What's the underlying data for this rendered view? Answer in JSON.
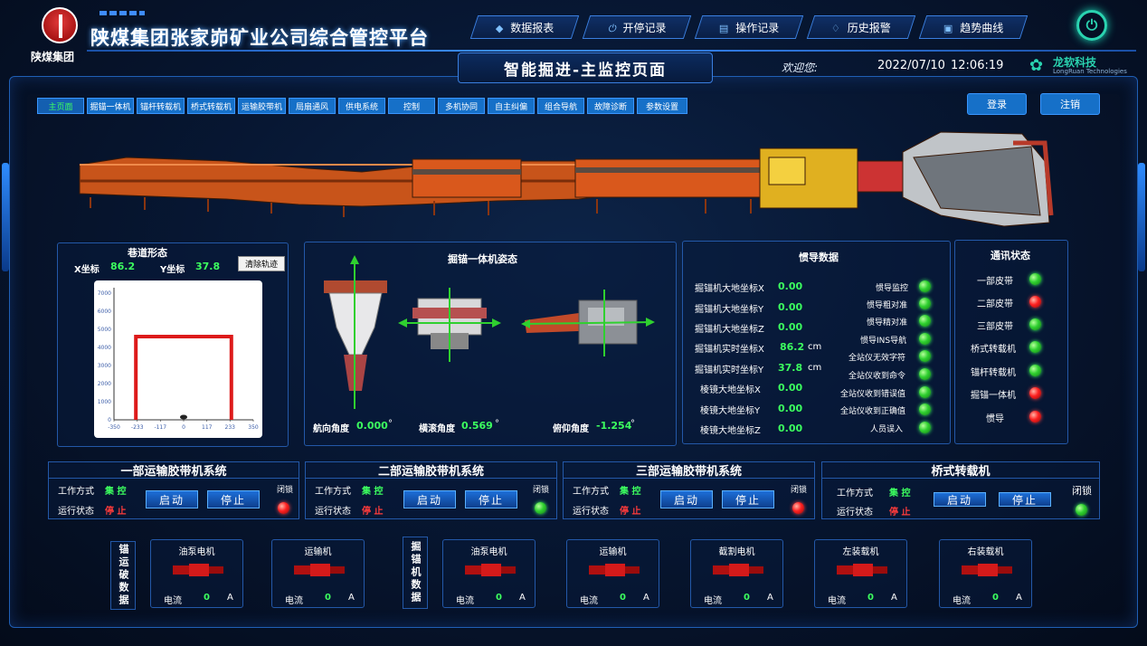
{
  "header": {
    "logo_text": "陕煤集团",
    "app_title": "陕煤集团张家峁矿业公司综合管控平台",
    "page_subtitle": "智能掘进-主监控页面",
    "welcome": "欢迎您:",
    "date": "2022/07/10",
    "time": "12:06:19",
    "brand_name": "龙软科技",
    "brand_sub": "LongRuan Technologies",
    "nav": [
      {
        "label": "数据报表",
        "icon": "database-icon"
      },
      {
        "label": "开停记录",
        "icon": "power-icon"
      },
      {
        "label": "操作记录",
        "icon": "document-icon"
      },
      {
        "label": "历史报警",
        "icon": "bell-icon"
      },
      {
        "label": "趋势曲线",
        "icon": "chart-icon"
      }
    ]
  },
  "tabs": [
    "主页面",
    "掘锚一体机",
    "锚杆转载机",
    "桥式转载机",
    "运输胶带机",
    "局扇通风",
    "供电系统",
    "控制",
    "多机协同",
    "自主纠偏",
    "组合导航",
    "故障诊断",
    "参数设置"
  ],
  "auth": {
    "login": "登录",
    "logout": "注销"
  },
  "roadway": {
    "title": "巷道形态",
    "x_label": "X坐标",
    "x_value": "86.2",
    "y_label": "Y坐标",
    "y_value": "37.8",
    "clear_button": "清除轨迹",
    "chart_data": {
      "type": "line",
      "x_ticks": [
        "-350",
        "-233",
        "-117",
        "0",
        "117",
        "233",
        "350"
      ],
      "y_ticks": [
        "0",
        "1000",
        "2000",
        "3000",
        "4000",
        "5000",
        "6000",
        "7000"
      ],
      "xlim": [
        -350,
        350
      ],
      "ylim": [
        0,
        7300
      ],
      "outline": {
        "x": [
          -240,
          -240,
          240,
          240
        ],
        "y": [
          0,
          4600,
          4600,
          0
        ],
        "color": "#dd1a1a"
      }
    }
  },
  "attitude": {
    "title": "掘锚一体机姿态",
    "heading_label": "航向角度",
    "heading_value": "0.000",
    "heading_unit": "°",
    "roll_label": "横滚角度",
    "roll_value": "0.569",
    "roll_unit": "°",
    "pitch_label": "俯仰角度",
    "pitch_value": "-1.254",
    "pitch_unit": "°"
  },
  "inertial": {
    "title": "惯导数据",
    "rows": [
      {
        "label": "掘锚机大地坐标X",
        "value": "0.00",
        "unit": ""
      },
      {
        "label": "掘锚机大地坐标Y",
        "value": "0.00",
        "unit": ""
      },
      {
        "label": "掘锚机大地坐标Z",
        "value": "0.00",
        "unit": ""
      },
      {
        "label": "掘锚机实时坐标X",
        "value": "86.2",
        "unit": "cm"
      },
      {
        "label": "掘锚机实时坐标Y",
        "value": "37.8",
        "unit": "cm"
      },
      {
        "label": "棱镜大地坐标X",
        "value": "0.00",
        "unit": ""
      },
      {
        "label": "棱镜大地坐标Y",
        "value": "0.00",
        "unit": ""
      },
      {
        "label": "棱镜大地坐标Z",
        "value": "0.00",
        "unit": ""
      }
    ],
    "status": [
      {
        "label": "惯导监控",
        "state": "green"
      },
      {
        "label": "惯导粗对准",
        "state": "green"
      },
      {
        "label": "惯导精对准",
        "state": "green"
      },
      {
        "label": "惯导INS导航",
        "state": "green"
      },
      {
        "label": "全站仪无效字符",
        "state": "green"
      },
      {
        "label": "全站仪收到命令",
        "state": "green"
      },
      {
        "label": "全站仪收到错误值",
        "state": "green"
      },
      {
        "label": "全站仪收到正确值",
        "state": "green"
      },
      {
        "label": "人员误入",
        "state": "green"
      }
    ]
  },
  "comm": {
    "title": "通讯状态",
    "items": [
      {
        "label": "一部皮带",
        "state": "green"
      },
      {
        "label": "二部皮带",
        "state": "red"
      },
      {
        "label": "三部皮带",
        "state": "green"
      },
      {
        "label": "桥式转载机",
        "state": "green"
      },
      {
        "label": "锚杆转载机",
        "state": "green"
      },
      {
        "label": "掘锚一体机",
        "state": "red"
      },
      {
        "label": "惯导",
        "state": "red"
      }
    ]
  },
  "systems": [
    {
      "title": "一部运输胶带机系统",
      "mode_label": "工作方式",
      "mode": "集 控",
      "status_label": "运行状态",
      "status": "停 止",
      "start": "启动",
      "stop": "停止",
      "lock": "闭锁",
      "lock_state": "red"
    },
    {
      "title": "二部运输胶带机系统",
      "mode_label": "工作方式",
      "mode": "集 控",
      "status_label": "运行状态",
      "status": "停 止",
      "start": "启动",
      "stop": "停止",
      "lock": "闭锁",
      "lock_state": "green"
    },
    {
      "title": "三部运输胶带机系统",
      "mode_label": "工作方式",
      "mode": "集 控",
      "status_label": "运行状态",
      "status": "停 止",
      "start": "启动",
      "stop": "停止",
      "lock": "闭锁",
      "lock_state": "red"
    },
    {
      "title": "桥式转载机",
      "mode_label": "工作方式",
      "mode": "集 控",
      "status_label": "运行状态",
      "status": "停 止",
      "start": "启动",
      "stop": "停止",
      "lock": "闭锁",
      "lock_state": "green"
    }
  ],
  "anchor_data_label": "锚运破数据",
  "anchor_units": [
    {
      "title": "油泵电机",
      "current_label": "电流",
      "current": "0",
      "unit": "A"
    },
    {
      "title": "运输机",
      "current_label": "电流",
      "current": "0",
      "unit": "A"
    }
  ],
  "miner_data_label": "掘锚机数据",
  "miner_units": [
    {
      "title": "油泵电机",
      "current_label": "电流",
      "current": "0",
      "unit": "A"
    },
    {
      "title": "运输机",
      "current_label": "电流",
      "current": "0",
      "unit": "A"
    },
    {
      "title": "截割电机",
      "current_label": "电流",
      "current": "0",
      "unit": "A"
    },
    {
      "title": "左装载机",
      "current_label": "电流",
      "current": "0",
      "unit": "A"
    },
    {
      "title": "右装载机",
      "current_label": "电流",
      "current": "0",
      "unit": "A"
    }
  ],
  "colors": {
    "accent": "#1670c8",
    "ok": "#3cff5f",
    "alarm": "#ff3b3b",
    "machine": "#d9581c"
  }
}
